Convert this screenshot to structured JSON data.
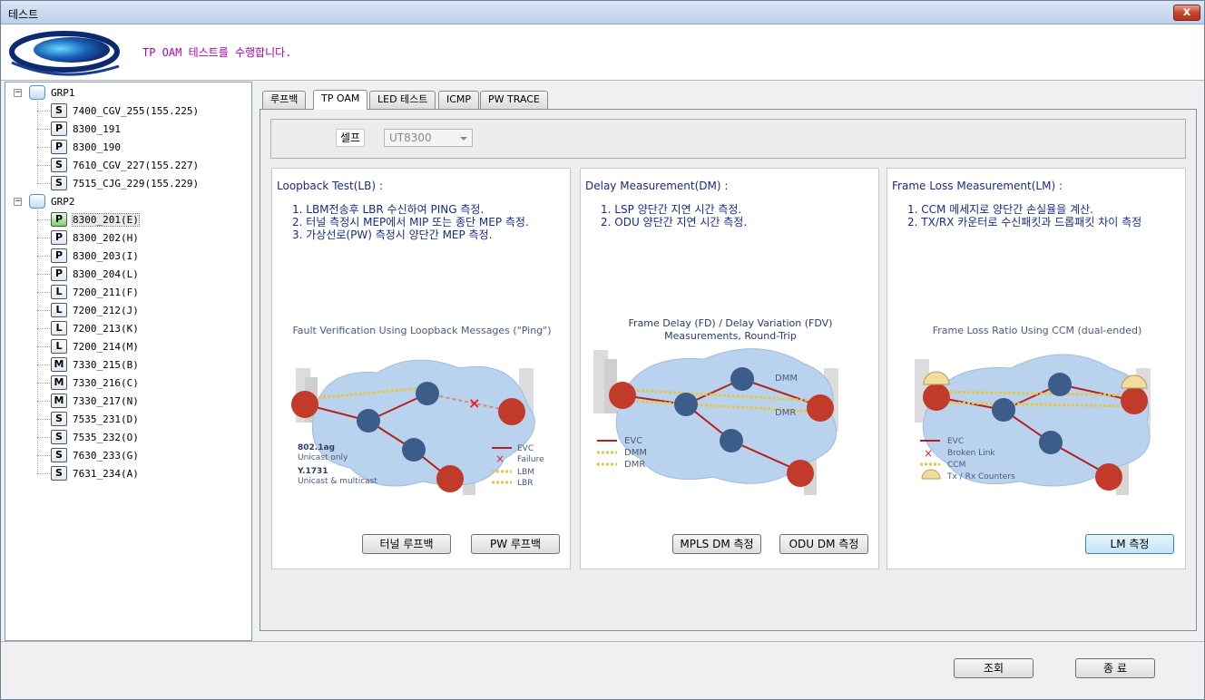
{
  "window": {
    "title": "테스트",
    "close_label": "x"
  },
  "header": {
    "message": "TP OAM 테스트를 수행합니다."
  },
  "tree": {
    "groups": [
      {
        "label": "GRP1",
        "nodes": [
          {
            "type": "S",
            "label": "7400_CGV_255(155.225)"
          },
          {
            "type": "P",
            "label": "8300_191"
          },
          {
            "type": "P",
            "label": "8300_190"
          },
          {
            "type": "S",
            "label": "7610_CGV_227(155.227)"
          },
          {
            "type": "S",
            "label": "7515_CJG_229(155.229)"
          }
        ]
      },
      {
        "label": "GRP2",
        "nodes": [
          {
            "type": "P",
            "label": "8300_201(E)"
          },
          {
            "type": "P",
            "label": "8300_202(H)"
          },
          {
            "type": "P",
            "label": "8300_203(I)"
          },
          {
            "type": "P",
            "label": "8300_204(L)"
          },
          {
            "type": "L",
            "label": "7200_211(F)"
          },
          {
            "type": "L",
            "label": "7200_212(J)"
          },
          {
            "type": "L",
            "label": "7200_213(K)"
          },
          {
            "type": "L",
            "label": "7200_214(M)"
          },
          {
            "type": "M",
            "label": "7330_215(B)"
          },
          {
            "type": "M",
            "label": "7330_216(C)"
          },
          {
            "type": "M",
            "label": "7330_217(N)"
          },
          {
            "type": "S",
            "label": "7535_231(D)"
          },
          {
            "type": "S",
            "label": "7535_232(O)"
          },
          {
            "type": "S",
            "label": "7630_233(G)"
          },
          {
            "type": "S",
            "label": "7631_234(A)"
          }
        ]
      }
    ]
  },
  "tabs": [
    "루프백",
    "TP OAM",
    "LED 테스트",
    "ICMP",
    "PW TRACE"
  ],
  "active_tab": "TP OAM",
  "self_label": "셀프",
  "self_select": "UT8300",
  "cards": {
    "lb": {
      "title": "Loopback Test(LB) :",
      "items": [
        "1. LBM전송후 LBR 수신하여 PING 측정.",
        "2. 터널 측정시 MEP에서 MIP 또는 종단 MEP 측정.",
        "3. 가상선로(PW) 측정시 양단간 MEP 측정."
      ],
      "diagram_title": "Fault Verification Using Loopback Messages (\"Ping\")",
      "note1_bold": "802.1ag",
      "note1": "Unicast only",
      "note2_bold": "Y.1731",
      "note2": "Unicast & multicast",
      "legend": [
        "EVC",
        "Failure",
        "LBM",
        "LBR"
      ],
      "buttons": [
        "터널 루프백",
        "PW 루프백"
      ]
    },
    "dm": {
      "title": "Delay Measurement(DM) :",
      "items": [
        "1. LSP 양단간 지연 시간 측정.",
        "2. ODU 양단간 지연 시간 측정."
      ],
      "diagram_title_1": "Frame Delay (FD) / Delay Variation (FDV)",
      "diagram_title_2": "Measurements, Round-Trip",
      "label_dmm": "DMM",
      "label_dmr": "DMR",
      "legend": [
        "EVC",
        "DMM",
        "DMR"
      ],
      "buttons": [
        "MPLS DM 측정",
        "ODU DM 측정"
      ]
    },
    "lm": {
      "title": "Frame Loss Measurement(LM) :",
      "items": [
        "1. CCM 메세지로 양단간 손실율을 계산.",
        "2. TX/RX 카운터로 수신패킷과 드롭패킷 차이 측정"
      ],
      "diagram_title": "Frame Loss Ratio Using CCM (dual-ended)",
      "legend": [
        "EVC",
        "Broken Link",
        "CCM",
        "Tx / Rx Counters"
      ],
      "buttons": [
        "LM 측정"
      ]
    }
  },
  "footer": {
    "query_label": "조회",
    "exit_label": "종  료"
  }
}
